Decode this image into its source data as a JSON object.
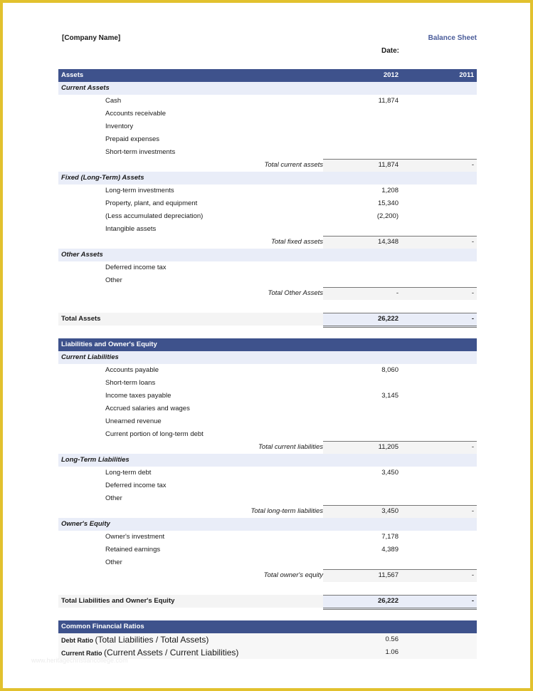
{
  "header": {
    "company_name": "[Company Name]",
    "title": "Balance Sheet",
    "date_label": "Date:"
  },
  "colors": {
    "header_bg": "#3e528c",
    "section_bg": "#e9edf8",
    "title": "#4a5c9a",
    "border": "#e2c12e"
  },
  "assets": {
    "header": {
      "label": "Assets",
      "col1": "2012",
      "col2": "2011"
    },
    "current": {
      "title": "Current Assets",
      "items": [
        {
          "label": "Cash",
          "v2012": "11,874",
          "v2011": ""
        },
        {
          "label": "Accounts receivable",
          "v2012": "",
          "v2011": ""
        },
        {
          "label": "Inventory",
          "v2012": "",
          "v2011": ""
        },
        {
          "label": "Prepaid expenses",
          "v2012": "",
          "v2011": ""
        },
        {
          "label": "Short-term investments",
          "v2012": "",
          "v2011": ""
        }
      ],
      "total": {
        "label": "Total current assets",
        "v2012": "11,874",
        "v2011": "-"
      }
    },
    "fixed": {
      "title": "Fixed (Long-Term) Assets",
      "items": [
        {
          "label": "Long-term investments",
          "v2012": "1,208",
          "v2011": ""
        },
        {
          "label": "Property, plant, and equipment",
          "v2012": "15,340",
          "v2011": ""
        },
        {
          "label": "(Less accumulated depreciation)",
          "v2012": "(2,200)",
          "v2011": ""
        },
        {
          "label": "Intangible assets",
          "v2012": "",
          "v2011": ""
        }
      ],
      "total": {
        "label": "Total fixed assets",
        "v2012": "14,348",
        "v2011": "-"
      }
    },
    "other": {
      "title": "Other Assets",
      "items": [
        {
          "label": "Deferred income tax",
          "v2012": "",
          "v2011": ""
        },
        {
          "label": "Other",
          "v2012": "",
          "v2011": ""
        }
      ],
      "total": {
        "label": "Total Other Assets",
        "v2012": "-",
        "v2011": "-"
      }
    },
    "grand_total": {
      "label": "Total Assets",
      "v2012": "26,222",
      "v2011": "-"
    }
  },
  "liabilities": {
    "header": {
      "label": "Liabilities and Owner's Equity"
    },
    "current": {
      "title": "Current Liabilities",
      "items": [
        {
          "label": "Accounts payable",
          "v2012": "8,060",
          "v2011": ""
        },
        {
          "label": "Short-term loans",
          "v2012": "",
          "v2011": ""
        },
        {
          "label": "Income taxes payable",
          "v2012": "3,145",
          "v2011": ""
        },
        {
          "label": "Accrued salaries and wages",
          "v2012": "",
          "v2011": ""
        },
        {
          "label": "Unearned revenue",
          "v2012": "",
          "v2011": ""
        },
        {
          "label": "Current portion of long-term debt",
          "v2012": "",
          "v2011": ""
        }
      ],
      "total": {
        "label": "Total current liabilities",
        "v2012": "11,205",
        "v2011": "-"
      }
    },
    "long_term": {
      "title": "Long-Term Liabilities",
      "items": [
        {
          "label": "Long-term debt",
          "v2012": "3,450",
          "v2011": ""
        },
        {
          "label": "Deferred income tax",
          "v2012": "",
          "v2011": ""
        },
        {
          "label": "Other",
          "v2012": "",
          "v2011": ""
        }
      ],
      "total": {
        "label": "Total long-term liabilities",
        "v2012": "3,450",
        "v2011": "-"
      }
    },
    "equity": {
      "title": "Owner's Equity",
      "items": [
        {
          "label": "Owner's investment",
          "v2012": "7,178",
          "v2011": ""
        },
        {
          "label": "Retained earnings",
          "v2012": "4,389",
          "v2011": ""
        },
        {
          "label": "Other",
          "v2012": "",
          "v2011": ""
        }
      ],
      "total": {
        "label": "Total owner's equity",
        "v2012": "11,567",
        "v2011": "-"
      }
    },
    "grand_total": {
      "label": "Total Liabilities and Owner's Equity",
      "v2012": "26,222",
      "v2011": "-"
    }
  },
  "ratios": {
    "header": "Common Financial Ratios",
    "items": [
      {
        "name": "Debt Ratio",
        "formula": "(Total Liabilities / Total Assets)",
        "value": "0.56"
      },
      {
        "name": "Current Ratio",
        "formula": "(Current Assets / Current Liabilities)",
        "value": "1.06"
      }
    ]
  },
  "watermark": "www.heritagechristiancollege.com"
}
